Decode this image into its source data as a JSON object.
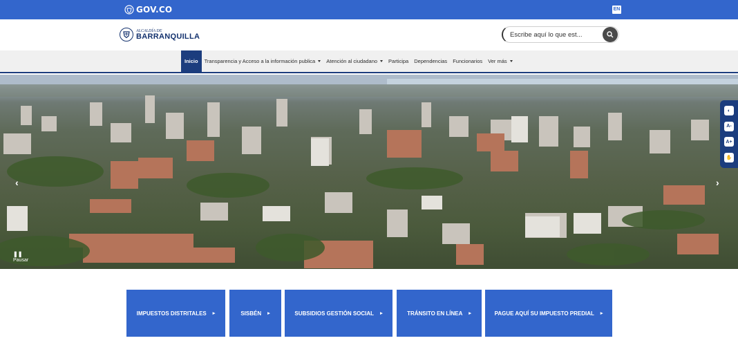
{
  "govbar": {
    "logo_text": "GOV.CO",
    "lang": "EN"
  },
  "header": {
    "brand_top": "ALCALDÍA DE",
    "brand_main": "BARRANQUILLA",
    "search_placeholder": "Escribe aquí lo que est..."
  },
  "nav": {
    "items": [
      {
        "label": "Inicio",
        "active": true,
        "dropdown": false
      },
      {
        "label": "Transparencia y Acceso a la información publica",
        "dropdown": true
      },
      {
        "label": "Atención al ciudadano",
        "dropdown": true
      },
      {
        "label": "Participa",
        "dropdown": false
      },
      {
        "label": "Dependencias",
        "dropdown": false
      },
      {
        "label": "Funcionarios",
        "dropdown": false
      },
      {
        "label": "Ver más",
        "dropdown": true
      }
    ]
  },
  "hero": {
    "pause_label": "Pausar",
    "prev_icon": "chevron-left-icon",
    "next_icon": "chevron-right-icon"
  },
  "accessibility": {
    "buttons": [
      "contrast-icon",
      "decrease-text-icon",
      "increase-text-icon",
      "sign-language-icon"
    ],
    "decrease_label": "A-",
    "increase_label": "A+"
  },
  "quick_links": [
    {
      "label": "IMPUESTOS DISTRITALES"
    },
    {
      "label": "SISBÉN"
    },
    {
      "label": "SUBSIDIOS GESTIÓN SOCIAL"
    },
    {
      "label": "TRÁNSITO EN LÍNEA"
    },
    {
      "label": "PAGUE AQUÍ SU IMPUESTO PREDIAL"
    }
  ],
  "colors": {
    "govbar": "#3366cc",
    "nav_active": "#1c3d7e",
    "quick_button": "#3366cc"
  }
}
